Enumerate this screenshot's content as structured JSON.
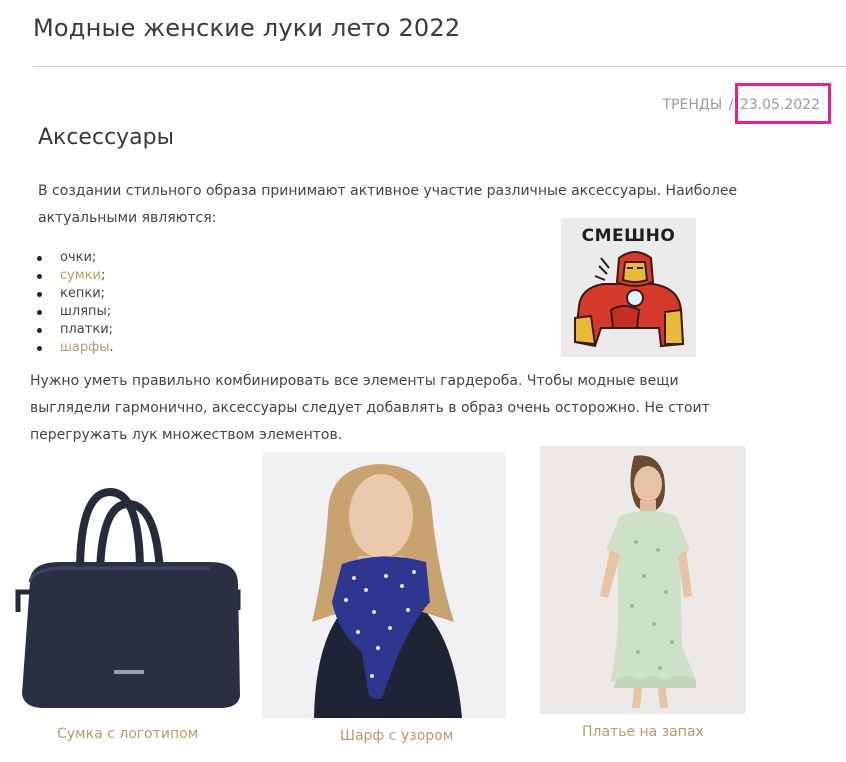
{
  "article": {
    "title": "Модные женские луки лето 2022",
    "category": "ТРЕНДЫ",
    "separator": "/",
    "date": "23.05.2022",
    "section_heading": "Аксессуары",
    "intro": "В создании стильного образа принимают активное участие различные аксессуары. Наиболее актуальными являются:",
    "accessories": [
      {
        "text": "очки",
        "punct": ";",
        "is_link": false
      },
      {
        "text": "сумки",
        "punct": ";",
        "is_link": true
      },
      {
        "text": "кепки",
        "punct": ";",
        "is_link": false
      },
      {
        "text": "шляпы",
        "punct": ";",
        "is_link": false
      },
      {
        "text": "платки",
        "punct": ";",
        "is_link": false
      },
      {
        "text": "шарфы",
        "punct": ".",
        "is_link": true
      }
    ],
    "body": "Нужно уметь правильно комбинировать все элементы гардероба. Чтобы модные вещи выглядели гармонично, аксессуары следует добавлять в образ очень осторожно. Не стоит перегружать лук множеством элементов."
  },
  "sticker": {
    "label": "СМЕШНО",
    "icon": "iron-man-sticker-icon"
  },
  "products": [
    {
      "caption": "Сумка с логотипом",
      "image": "handbag-image"
    },
    {
      "caption": "Шарф с узором",
      "image": "scarf-model-image"
    },
    {
      "caption": "Платье на запах",
      "image": "wrap-dress-model-image"
    }
  ],
  "colors": {
    "link": "#b89a6a",
    "highlight": "#e81e8c",
    "rule": "#cfcfcf"
  }
}
